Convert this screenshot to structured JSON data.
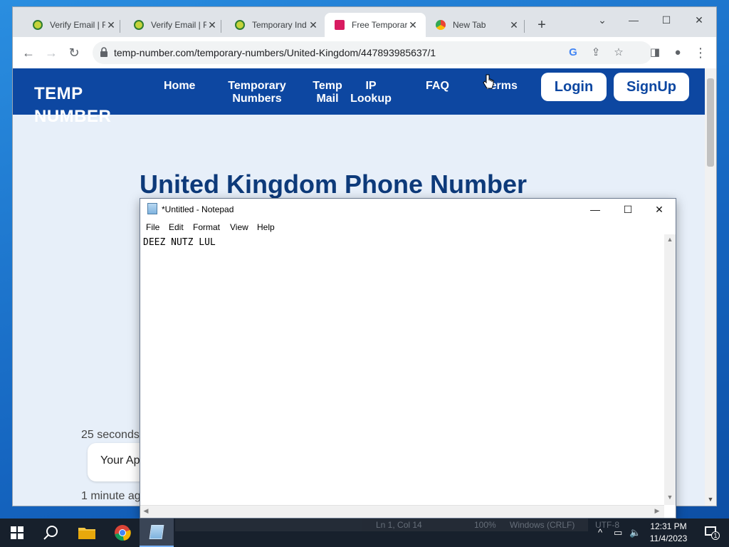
{
  "browser": {
    "tabs": [
      {
        "title": "Verify Email | F",
        "favicon_color": "#c5d33a",
        "active": false
      },
      {
        "title": "Verify Email | F",
        "favicon_color": "#c5d33a",
        "active": false
      },
      {
        "title": "Temporary Ind",
        "favicon_color": "#c5d33a",
        "active": false
      },
      {
        "title": "Free Temporar",
        "favicon_color": "#d81b60",
        "active": true
      },
      {
        "title": "New Tab",
        "favicon_color": "#5f6368",
        "active": false
      }
    ],
    "new_tab_label": "+",
    "url": "temp-number.com/temporary-numbers/United-Kingdom/447893985637/1"
  },
  "site": {
    "logo": "TEMP NUMBER",
    "nav": {
      "home": "Home",
      "temporary_numbers": "Temporary Numbers",
      "temp_mail": "Temp Mail",
      "ip_lookup": "IP Lookup",
      "faq": "FAQ",
      "terms": "Terms"
    },
    "login": "Login",
    "signup": "SignUp",
    "headline": "United Kingdom Phone Number",
    "messages": [
      {
        "time": "25 seconds",
        "text": "Your Ap"
      },
      {
        "time": "1 minute ag",
        "text": ""
      }
    ]
  },
  "notepad": {
    "title": "*Untitled - Notepad",
    "menu": [
      "File",
      "Edit",
      "Format",
      "View",
      "Help"
    ],
    "content": "DEEZ NUTZ LUL"
  },
  "taskbar": {
    "status_strip": [
      "Ln 1, Col 14",
      "100%",
      "Windows (CRLF)",
      "UTF-8"
    ],
    "time": "12:31 PM",
    "date": "11/4/2023",
    "notification_count": "1"
  }
}
